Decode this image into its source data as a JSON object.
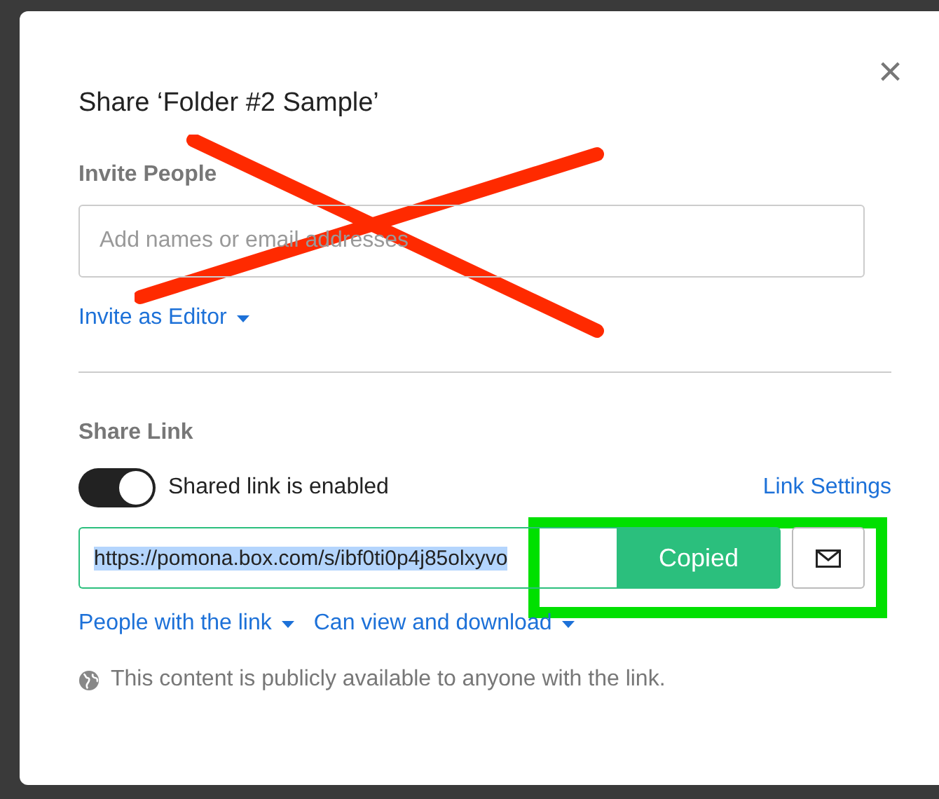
{
  "dialog": {
    "title": "Share ‘Folder #2 Sample’",
    "close": "×"
  },
  "invite": {
    "heading": "Invite People",
    "placeholder": "Add names or email addresses",
    "role_menu": "Invite as Editor"
  },
  "share_link": {
    "heading": "Share Link",
    "toggle": {
      "on": true,
      "label": "Shared link is enabled"
    },
    "settings_link": "Link Settings",
    "url": {
      "value": "https://pomona.box.com/s/ibf0ti0p4j85olxyvo",
      "selected": true
    },
    "copy_button": "Copied",
    "menus": [
      "People with the link",
      "Can view and download"
    ],
    "note": "This content is publicly available to anyone with the link."
  },
  "annotations": [
    {
      "kind": "cross",
      "color": "#ff2a00"
    },
    {
      "kind": "frame",
      "color": "#00e000"
    }
  ]
}
